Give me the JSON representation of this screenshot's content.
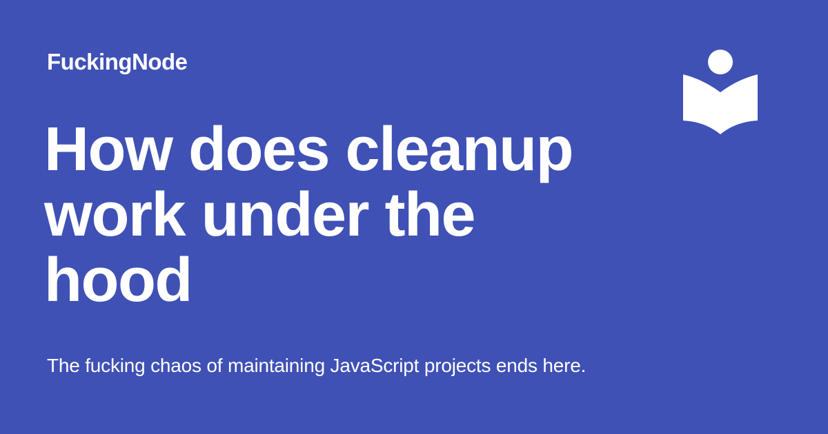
{
  "brand": {
    "name": "FuckingNode",
    "logo_icon": "book-reader-icon"
  },
  "article": {
    "title": "How does cleanup work under the hood",
    "subtitle": "The fucking chaos of maintaining JavaScript projects ends here."
  },
  "theme": {
    "background": "#3f51b5",
    "text": "#ffffff"
  }
}
